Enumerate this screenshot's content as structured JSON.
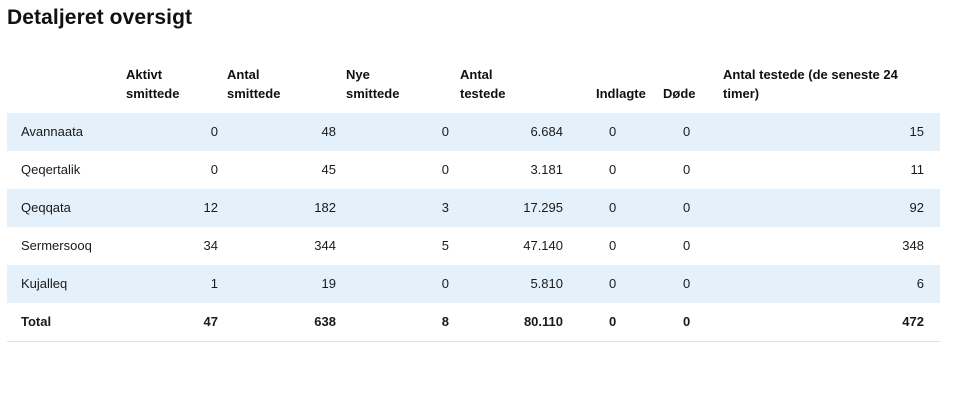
{
  "title": "Detaljeret oversigt",
  "table": {
    "headers": {
      "aktivt": "Aktivt smittede",
      "antal_smittede": "Antal smittede",
      "nye": "Nye smittede",
      "antal_testede": "Antal testede",
      "indlagte": "Indlagte",
      "doede": "Døde",
      "testede_24": "Antal testede (de seneste 24 timer)"
    },
    "rows": [
      {
        "region": "Avannaata",
        "aktivt": "0",
        "antal_smittede": "48",
        "nye": "0",
        "antal_testede": "6.684",
        "indlagte": "0",
        "doede": "0",
        "testede_24": "15"
      },
      {
        "region": "Qeqertalik",
        "aktivt": "0",
        "antal_smittede": "45",
        "nye": "0",
        "antal_testede": "3.181",
        "indlagte": "0",
        "doede": "0",
        "testede_24": "11"
      },
      {
        "region": "Qeqqata",
        "aktivt": "12",
        "antal_smittede": "182",
        "nye": "3",
        "antal_testede": "17.295",
        "indlagte": "0",
        "doede": "0",
        "testede_24": "92"
      },
      {
        "region": "Sermersooq",
        "aktivt": "34",
        "antal_smittede": "344",
        "nye": "5",
        "antal_testede": "47.140",
        "indlagte": "0",
        "doede": "0",
        "testede_24": "348"
      },
      {
        "region": "Kujalleq",
        "aktivt": "1",
        "antal_smittede": "19",
        "nye": "0",
        "antal_testede": "5.810",
        "indlagte": "0",
        "doede": "0",
        "testede_24": "6"
      }
    ],
    "total": {
      "region": "Total",
      "aktivt": "47",
      "antal_smittede": "638",
      "nye": "8",
      "antal_testede": "80.110",
      "indlagte": "0",
      "doede": "0",
      "testede_24": "472"
    }
  }
}
